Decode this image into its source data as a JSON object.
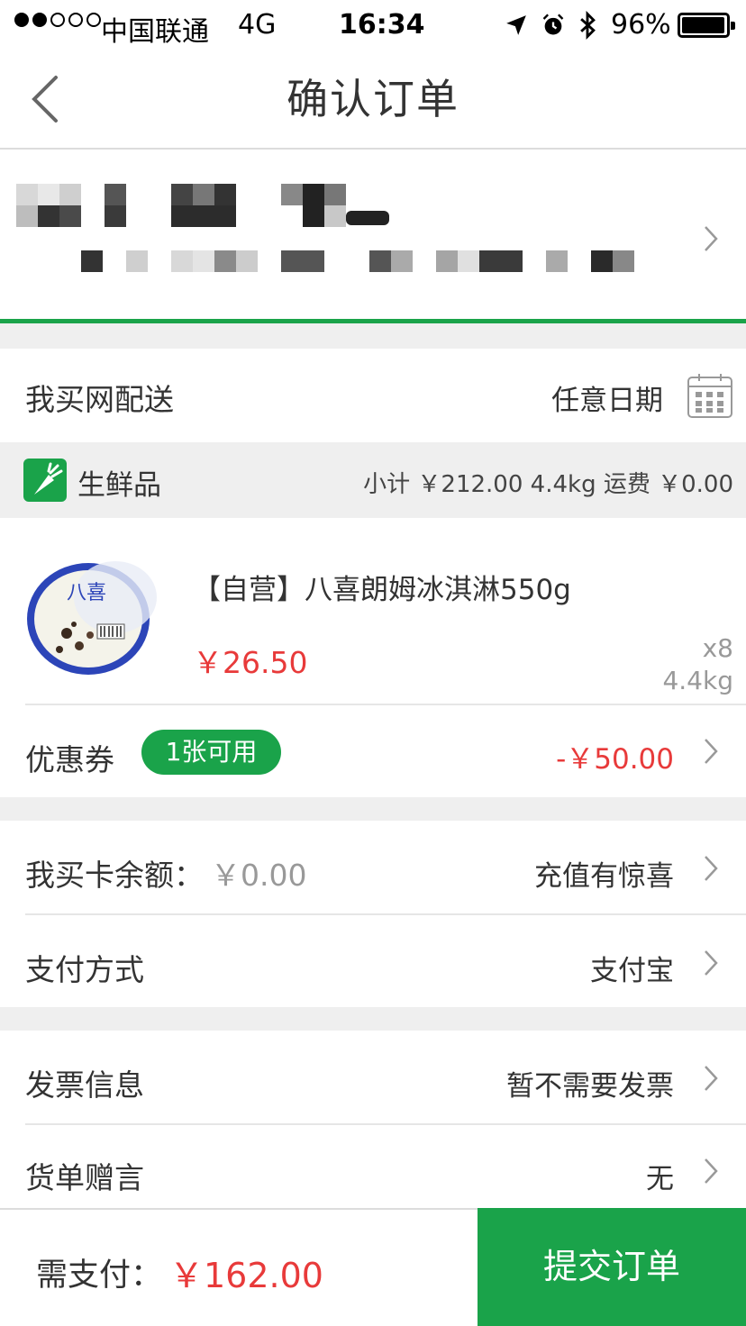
{
  "status_bar": {
    "carrier": "中国联通",
    "network": "4G",
    "time": "16:34",
    "battery": "96%",
    "signal_level": 0.4,
    "icons": [
      "location-arrow-icon",
      "alarm-clock-icon",
      "bluetooth-icon",
      "battery-icon"
    ]
  },
  "nav": {
    "title": "确认订单",
    "back_icon": "chevron-left-icon"
  },
  "delivery": {
    "label": "我买网配送",
    "date_text": "任意日期",
    "calendar_icon": "calendar-icon"
  },
  "category": {
    "name": "生鲜品",
    "summary": "小计 ￥212.00 4.4kg 运费 ￥0.00",
    "icon": "carrot-icon"
  },
  "product": {
    "name": "【自营】八喜朗姆冰淇淋550g",
    "price": "￥26.50",
    "quantity": "x8",
    "weight": "4.4kg",
    "image_brand": "八喜"
  },
  "coupon": {
    "label": "优惠券",
    "badge": "1张可用",
    "discount": "-￥50.00"
  },
  "card_balance": {
    "label": "我买卡余额：",
    "value": "￥0.00",
    "right": "充值有惊喜"
  },
  "payment": {
    "label": "支付方式",
    "value": "支付宝"
  },
  "invoice": {
    "label": "发票信息",
    "value": "暂不需要发票"
  },
  "gift": {
    "label": "货单赠言",
    "value": "无"
  },
  "footer": {
    "total_label": "需支付：",
    "total_value": "￥162.00",
    "submit": "提交订单"
  },
  "colors": {
    "accent_green": "#1aa34a",
    "price_red": "#e83a3a",
    "gray_bg": "#efefef"
  }
}
